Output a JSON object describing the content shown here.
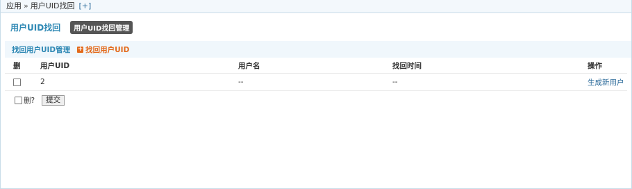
{
  "breadcrumb": {
    "root": "应用",
    "separator": "»",
    "current": "用户UID找回",
    "add_shortcut": "[+]"
  },
  "header": {
    "title": "用户UID找回",
    "badge": "用户UID找回管理"
  },
  "subnav": {
    "manage_label": "找回用户UID管理",
    "add_icon": "+",
    "add_label": "找回用户UID"
  },
  "table": {
    "columns": [
      "删",
      "用户UID",
      "用户名",
      "找回时间",
      "操作"
    ],
    "rows": [
      {
        "uid": "2",
        "username": "--",
        "time": "--",
        "action": "生成新用户"
      }
    ]
  },
  "footer": {
    "delete_label": "删?",
    "submit_label": "提交"
  }
}
